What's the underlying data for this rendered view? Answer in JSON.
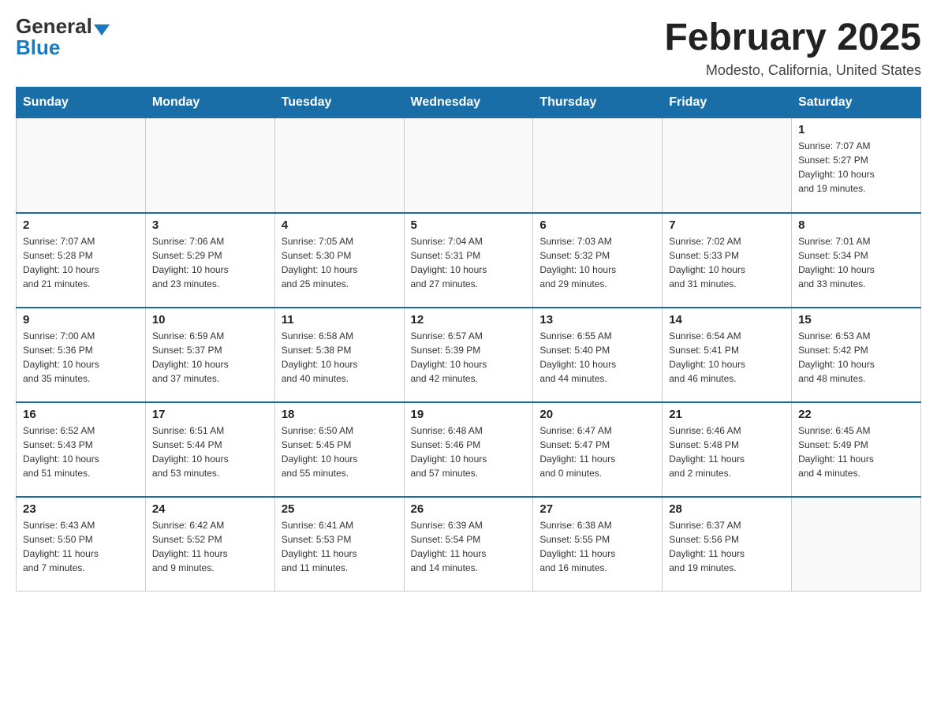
{
  "header": {
    "logo_general": "General",
    "logo_blue": "Blue",
    "title": "February 2025",
    "location": "Modesto, California, United States"
  },
  "days_of_week": [
    "Sunday",
    "Monday",
    "Tuesday",
    "Wednesday",
    "Thursday",
    "Friday",
    "Saturday"
  ],
  "weeks": [
    [
      {
        "day": "",
        "info": ""
      },
      {
        "day": "",
        "info": ""
      },
      {
        "day": "",
        "info": ""
      },
      {
        "day": "",
        "info": ""
      },
      {
        "day": "",
        "info": ""
      },
      {
        "day": "",
        "info": ""
      },
      {
        "day": "1",
        "info": "Sunrise: 7:07 AM\nSunset: 5:27 PM\nDaylight: 10 hours\nand 19 minutes."
      }
    ],
    [
      {
        "day": "2",
        "info": "Sunrise: 7:07 AM\nSunset: 5:28 PM\nDaylight: 10 hours\nand 21 minutes."
      },
      {
        "day": "3",
        "info": "Sunrise: 7:06 AM\nSunset: 5:29 PM\nDaylight: 10 hours\nand 23 minutes."
      },
      {
        "day": "4",
        "info": "Sunrise: 7:05 AM\nSunset: 5:30 PM\nDaylight: 10 hours\nand 25 minutes."
      },
      {
        "day": "5",
        "info": "Sunrise: 7:04 AM\nSunset: 5:31 PM\nDaylight: 10 hours\nand 27 minutes."
      },
      {
        "day": "6",
        "info": "Sunrise: 7:03 AM\nSunset: 5:32 PM\nDaylight: 10 hours\nand 29 minutes."
      },
      {
        "day": "7",
        "info": "Sunrise: 7:02 AM\nSunset: 5:33 PM\nDaylight: 10 hours\nand 31 minutes."
      },
      {
        "day": "8",
        "info": "Sunrise: 7:01 AM\nSunset: 5:34 PM\nDaylight: 10 hours\nand 33 minutes."
      }
    ],
    [
      {
        "day": "9",
        "info": "Sunrise: 7:00 AM\nSunset: 5:36 PM\nDaylight: 10 hours\nand 35 minutes."
      },
      {
        "day": "10",
        "info": "Sunrise: 6:59 AM\nSunset: 5:37 PM\nDaylight: 10 hours\nand 37 minutes."
      },
      {
        "day": "11",
        "info": "Sunrise: 6:58 AM\nSunset: 5:38 PM\nDaylight: 10 hours\nand 40 minutes."
      },
      {
        "day": "12",
        "info": "Sunrise: 6:57 AM\nSunset: 5:39 PM\nDaylight: 10 hours\nand 42 minutes."
      },
      {
        "day": "13",
        "info": "Sunrise: 6:55 AM\nSunset: 5:40 PM\nDaylight: 10 hours\nand 44 minutes."
      },
      {
        "day": "14",
        "info": "Sunrise: 6:54 AM\nSunset: 5:41 PM\nDaylight: 10 hours\nand 46 minutes."
      },
      {
        "day": "15",
        "info": "Sunrise: 6:53 AM\nSunset: 5:42 PM\nDaylight: 10 hours\nand 48 minutes."
      }
    ],
    [
      {
        "day": "16",
        "info": "Sunrise: 6:52 AM\nSunset: 5:43 PM\nDaylight: 10 hours\nand 51 minutes."
      },
      {
        "day": "17",
        "info": "Sunrise: 6:51 AM\nSunset: 5:44 PM\nDaylight: 10 hours\nand 53 minutes."
      },
      {
        "day": "18",
        "info": "Sunrise: 6:50 AM\nSunset: 5:45 PM\nDaylight: 10 hours\nand 55 minutes."
      },
      {
        "day": "19",
        "info": "Sunrise: 6:48 AM\nSunset: 5:46 PM\nDaylight: 10 hours\nand 57 minutes."
      },
      {
        "day": "20",
        "info": "Sunrise: 6:47 AM\nSunset: 5:47 PM\nDaylight: 11 hours\nand 0 minutes."
      },
      {
        "day": "21",
        "info": "Sunrise: 6:46 AM\nSunset: 5:48 PM\nDaylight: 11 hours\nand 2 minutes."
      },
      {
        "day": "22",
        "info": "Sunrise: 6:45 AM\nSunset: 5:49 PM\nDaylight: 11 hours\nand 4 minutes."
      }
    ],
    [
      {
        "day": "23",
        "info": "Sunrise: 6:43 AM\nSunset: 5:50 PM\nDaylight: 11 hours\nand 7 minutes."
      },
      {
        "day": "24",
        "info": "Sunrise: 6:42 AM\nSunset: 5:52 PM\nDaylight: 11 hours\nand 9 minutes."
      },
      {
        "day": "25",
        "info": "Sunrise: 6:41 AM\nSunset: 5:53 PM\nDaylight: 11 hours\nand 11 minutes."
      },
      {
        "day": "26",
        "info": "Sunrise: 6:39 AM\nSunset: 5:54 PM\nDaylight: 11 hours\nand 14 minutes."
      },
      {
        "day": "27",
        "info": "Sunrise: 6:38 AM\nSunset: 5:55 PM\nDaylight: 11 hours\nand 16 minutes."
      },
      {
        "day": "28",
        "info": "Sunrise: 6:37 AM\nSunset: 5:56 PM\nDaylight: 11 hours\nand 19 minutes."
      },
      {
        "day": "",
        "info": ""
      }
    ]
  ]
}
